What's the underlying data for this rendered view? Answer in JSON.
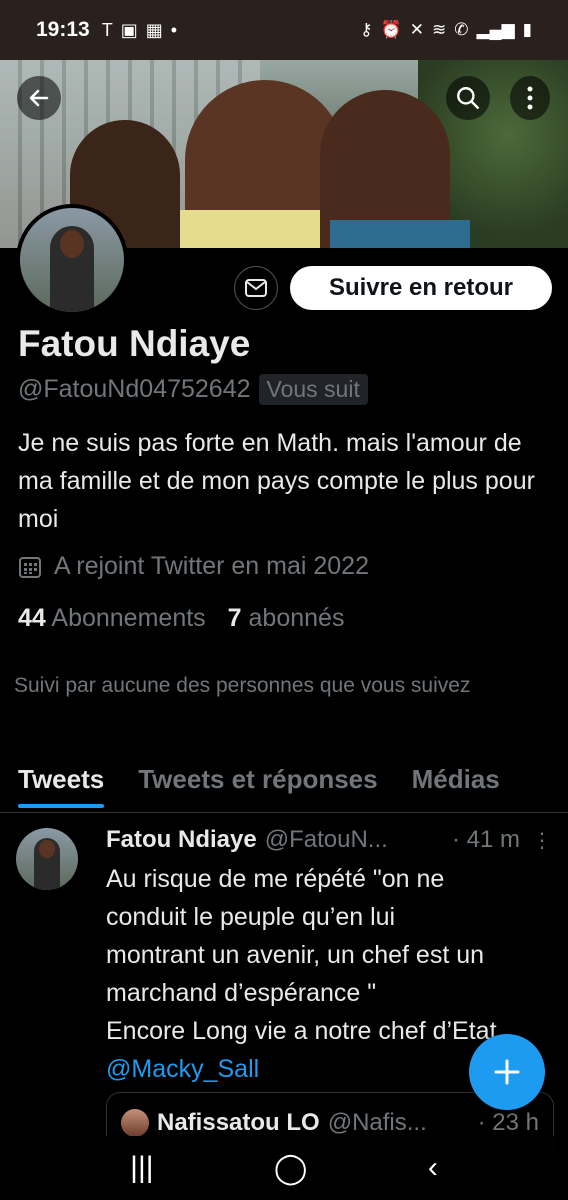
{
  "status_bar": {
    "time": "19:13"
  },
  "profile": {
    "follow_back_label": "Suivre en retour",
    "name": "Fatou Ndiaye",
    "handle": "@FatouNd04752642",
    "follows_you_badge": "Vous suit",
    "bio": "Je ne suis pas forte en Math. mais l'amour de ma famille et de mon pays compte le plus pour moi",
    "joined": "A rejoint Twitter en mai 2022",
    "following_count": "44",
    "following_label": "Abonnements",
    "followers_count": "7",
    "followers_label": "abonnés",
    "followed_by": "Suivi par aucune des personnes que vous suivez"
  },
  "tabs": [
    {
      "label": "Tweets",
      "active": true
    },
    {
      "label": "Tweets et réponses",
      "active": false
    },
    {
      "label": "Médias",
      "active": false
    }
  ],
  "tweet": {
    "author_name": "Fatou Ndiaye",
    "author_handle": "@FatouN...",
    "time": "· 41 m",
    "text_lines": [
      "Au risque de me répété \"on ne",
      "conduit le peuple qu’en lui",
      "montrant un avenir, un chef est un",
      "marchand d’espérance \"",
      "Encore Long vie a notre chef d’Etat"
    ],
    "mention": "@Macky_Sall",
    "quote": {
      "author_name": "Nafissatou LO",
      "author_handle": "@Nafis...",
      "time": "· 23 h"
    }
  },
  "colors": {
    "accent": "#1d9bf0",
    "background": "#000000",
    "secondary_text": "#71767b"
  }
}
